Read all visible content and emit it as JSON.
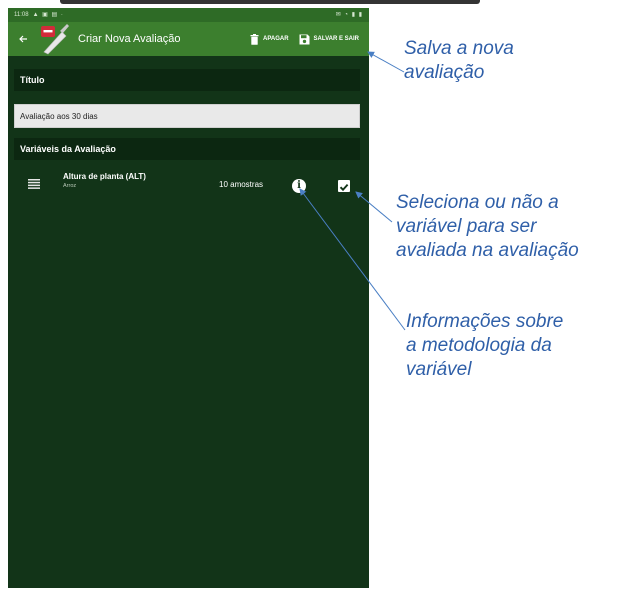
{
  "status_bar": {
    "time": "11:08",
    "icons_left": "▲ ▣ ▤ ·",
    "icons_right": "✉ ◔ ▮ ▮"
  },
  "app_bar": {
    "back_icon": "back-arrow-icon",
    "title": "Criar Nova Avaliação",
    "actions": [
      {
        "label": "APAGAR",
        "icon": "trash-icon"
      },
      {
        "label": "SALVAR E SAIR",
        "icon": "save-icon"
      }
    ]
  },
  "form": {
    "title_label": "Título",
    "title_value": "Avaliação aos 30 dias",
    "variables_label": "Variáveis da Avaliação"
  },
  "variables": [
    {
      "name": "Altura de planta (ALT)",
      "crop": "Arroz",
      "samples": "10 amostras",
      "selected": true
    }
  ],
  "annotations": [
    {
      "lines": [
        "Salva a nova",
        "avaliação"
      ]
    },
    {
      "lines": [
        "Seleciona ou não a",
        "variável para ser",
        "avaliada na avaliação"
      ]
    },
    {
      "lines": [
        "Informações sobre",
        "a metodologia da",
        "variável"
      ]
    }
  ],
  "colors": {
    "app_bar": "#3c7f2e",
    "background": "#123418",
    "section_header": "#0c2711",
    "annotation": "#2f5fa8"
  }
}
